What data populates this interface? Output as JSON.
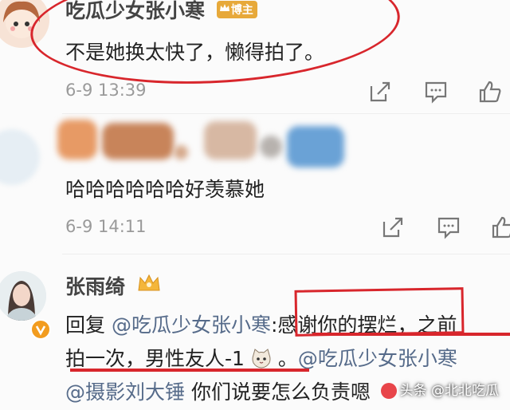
{
  "comments": [
    {
      "name": "吃瓜少女张小寒",
      "badge": "博主",
      "text": "不是她换太快了，懒得拍了。",
      "time": "6-9 13:39"
    },
    {
      "name": "",
      "text": "哈哈哈哈哈哈好羡慕她",
      "time": "6-9 14:11"
    },
    {
      "name": "张雨绮",
      "line1": {
        "reply": "回复",
        "mention1": "@吃瓜少女张小寒",
        "colon": ":",
        "highlight": "感谢你的摆烂",
        "rest": "，之前"
      },
      "line2": {
        "part1": "拍一次，男性友人-1",
        "part2": "。",
        "mention2": "@吃瓜少女张小寒"
      },
      "line3": {
        "mention3": "@摄影刘大锤",
        "rest": " 你们说要怎么负责嗯"
      }
    }
  ],
  "watermark": "头条 @北北吃瓜",
  "icons": [
    "share-icon",
    "comment-icon",
    "like-icon",
    "crown-icon",
    "verified-icon",
    "cat-emoji-icon"
  ],
  "colors": {
    "annotation": "#d8262c",
    "badge": "#e7a93a",
    "mention": "#566b8a"
  }
}
